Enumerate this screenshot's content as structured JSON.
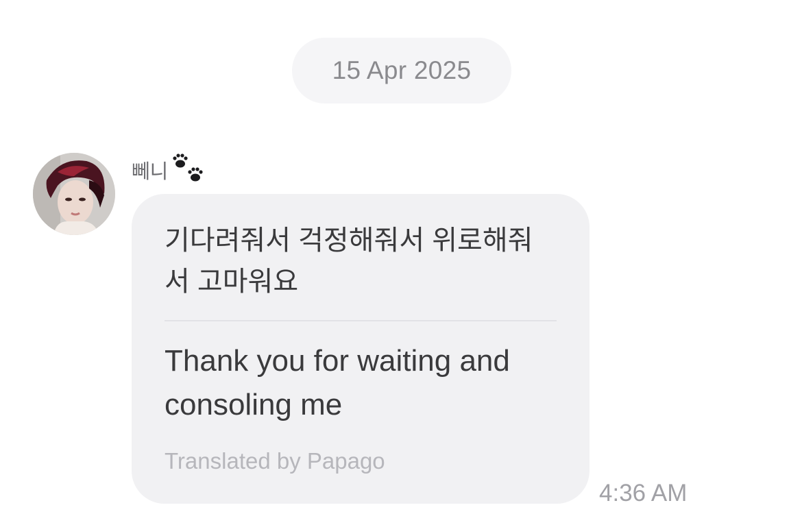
{
  "date_separator": "15 Apr 2025",
  "sender": {
    "name": "뻬니",
    "emoji_icon": "paw-prints-icon"
  },
  "message": {
    "original_text": "기다려줘서 걱정해줘서 위로해줘서 고마워요",
    "translated_text": "Thank you for waiting and consoling me",
    "translation_credit": "Translated by Papago",
    "time": "4:36 AM"
  },
  "colors": {
    "bubble_background": "#f1f1f3",
    "date_pill_background": "#f5f5f7",
    "message_text": "#3a3a3c",
    "secondary_text": "#a1a1a6"
  }
}
